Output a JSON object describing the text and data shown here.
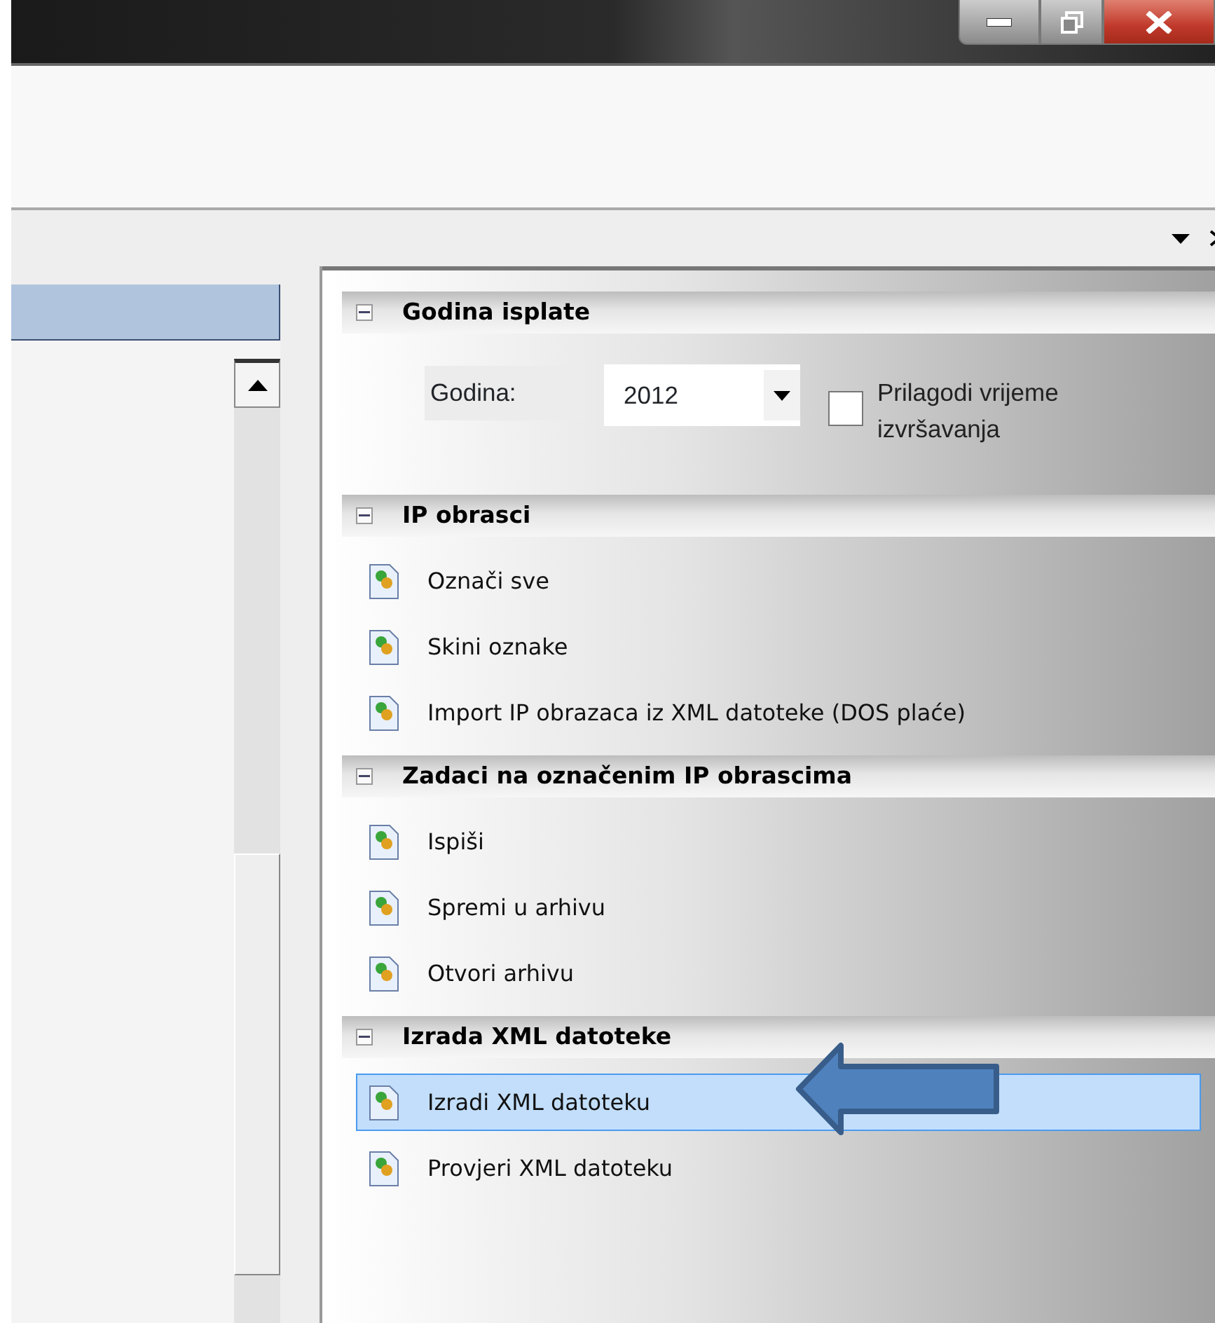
{
  "task_panel": {
    "sections": [
      {
        "kind": "settings",
        "title": "Godina isplate",
        "expanded": true,
        "year_label": "Godina:",
        "year": "2012",
        "adjust_time": {
          "label": "Prilagodi vrijeme izvršavanja",
          "checked": false
        }
      },
      {
        "kind": "tasks",
        "title": "IP obrasci",
        "expanded": true,
        "items": [
          {
            "label": "Označi sve",
            "selected": false
          },
          {
            "label": "Skini oznake",
            "selected": false
          },
          {
            "label": "Import IP obrazaca iz XML datoteke (DOS plaće)",
            "selected": false
          }
        ]
      },
      {
        "kind": "tasks",
        "title": "Zadaci na označenim IP obrascima",
        "expanded": true,
        "items": [
          {
            "label": "Ispiši",
            "selected": false
          },
          {
            "label": "Spremi u arhivu",
            "selected": false
          },
          {
            "label": "Otvori arhivu",
            "selected": false
          }
        ]
      },
      {
        "kind": "tasks",
        "title": "Izrada XML datoteke",
        "expanded": true,
        "items": [
          {
            "label": "Izradi XML datoteku",
            "selected": true
          },
          {
            "label": "Provjeri XML datoteku",
            "selected": false
          }
        ]
      }
    ]
  }
}
